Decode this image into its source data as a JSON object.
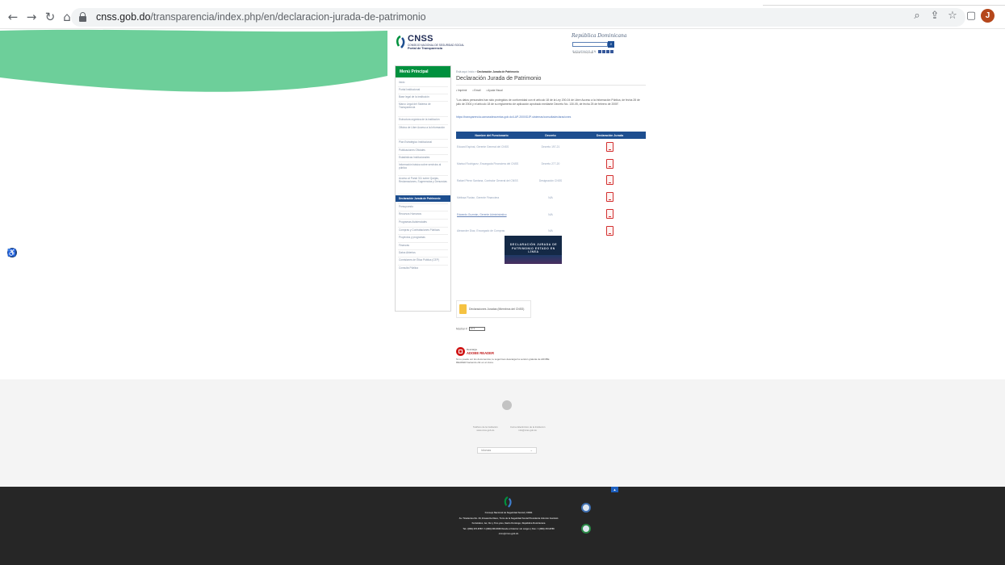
{
  "browser": {
    "back_icon": "arrow-left-icon",
    "forward_icon": "arrow-right-icon",
    "reload_icon": "reload-icon",
    "home_icon": "home-icon",
    "url_host": "cnss.gob.do",
    "url_path": "/transparencia/index.php/en/declaracion-jurada-de-patrimonio",
    "toolbar_icons": [
      "zoom-icon",
      "share-icon",
      "star-icon",
      "sidepanel-icon"
    ],
    "profile_initial": "J"
  },
  "header": {
    "brand": "CNSS",
    "brand_sub": "CONSEJO NACIONAL DE SEGURIDAD SOCIAL",
    "portal": "Portal de Transparencia",
    "gov": "República Dominicana",
    "search_placeholder": "Buscar en el portal",
    "social_label": "SIGUENOS EN"
  },
  "menu": {
    "title": "Menú Principal",
    "items": [
      "Inicio",
      "Portal Institucional",
      "Base legal de la institución",
      "Marco Legal del Sistema de Transparencia",
      "Estructura orgánica de la institución",
      "Oficina de Libre Acceso a la Información",
      "Plan Estratégico Institucional",
      "Publicaciones Oficiales",
      "Estadísticas Institucionales",
      "Información básica sobre servicios al público",
      "Acceso al Portal 311 sobre Quejas, Reclamaciones, Sugerencias y Denuncias",
      "Declaración Jurada de Patrimonio",
      "Presupuesto",
      "Recursos Humanos",
      "Programas Asistenciales",
      "Compras y Contrataciones Públicas",
      "Proyectos y programas",
      "Finanzas",
      "Datos Abiertos",
      "Comisiones de Ética Pública (CEP)",
      "Consulta Pública"
    ],
    "active_index": 11
  },
  "main": {
    "breadcrumb_prefix": "Está aquí: Inicio »",
    "breadcrumb_current": "Declaración Jurada de Patrimonio",
    "title": "Declaración Jurada de Patrimonio",
    "tools": [
      "▪ Imprimir",
      "▪ Email",
      "▪ Ayuda Visual"
    ],
    "intro": "\"Los datos personales han sido protegidos de conformidad con el artículo 18 de la Ley 200-04 de Libre Acceso a la Información Pública, de fecha 28 de julio de 2004 y el artículo 18 de su reglamento de aplicación aprobado mediante Decreto No. 130-05, de fecha 25 de febrero de 2005\".",
    "intro_link": "https://transparencia.camaradecuentas.gob.do/LAP-2000/DJP-sistemas/consultadeclaraciones",
    "table": {
      "headers": [
        "Nombre del Funcionario",
        "Decreto",
        "Declaración Jurada"
      ],
      "rows": [
        {
          "name": "Eduard Espinal, Gerente General del CNSS",
          "decree": "Decreto 197-21"
        },
        {
          "name": "Marisol Rodríguez, Encargada Financiera del CNSS",
          "decree": "Decreto 277-20"
        },
        {
          "name": "Rafael Pérez Santana, Contralor General del CNSS",
          "decree": "Designación CNSS"
        },
        {
          "name": "Melissa Florian, Gerente Financiera",
          "decree": "N/A"
        },
        {
          "name": "Edwardo Guzmán, Gerente Administrativo",
          "decree": "N/A"
        },
        {
          "name": "Alexander Díaz, Encargado de Compras",
          "decree": "N/A"
        }
      ]
    },
    "banner": "DECLARACIÓN JURADA DE PATRIMONIO ESTADO EN LÍNEA",
    "folder_label": "Declaraciones Juradas (Miembros del CNSS)",
    "period_label": "Mostrar #:",
    "period_value": "10",
    "reader_l1": "Descarga",
    "reader_l2": "ADOBE READER",
    "reader_l3": "Si no puede ver los documentos, le sugerimos descargar la versión gratuita de ADOBE READER haciendo clic en el icono."
  },
  "footer": {
    "col1_title": "Teléfono de la Institución",
    "col1_value": "www.cnss.gob.do",
    "col2_title": "Correo Electrónico de la Institución",
    "col2_value": "info@cnss.gob.do",
    "language": "Idiomas",
    "org": "Consejo Nacional de Seguridad Social | CNSS",
    "address1": "Av. Tiradentes No. 33, Ensanche Naco, Torre de la Seguridad Social Presidente Antonio Guzmán",
    "address2": "Fernández, 1er, 4to y 7mo piso, Santo Domingo, República Dominicana",
    "phone": "Tel.: (809) 472-8787 / 1 (809) 200-6036 Desde el Interior sin cargos | Fax.: 1 (809) 472-8788",
    "email": "cnss@cnss.gob.do"
  },
  "colors": {
    "menu_header": "#00913e",
    "active": "#1d4e8f",
    "wave": "#6dcf9a",
    "footer_dark": "#262626"
  }
}
